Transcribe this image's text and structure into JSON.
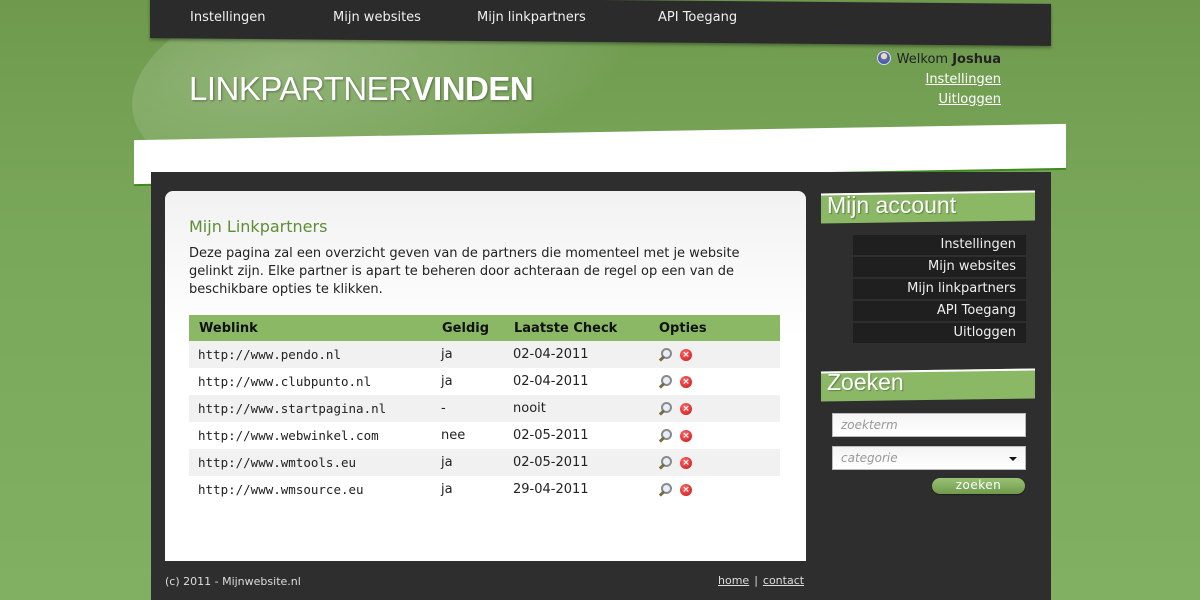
{
  "colors": {
    "accent": "#8bb865",
    "dark": "#2e2e2e",
    "heading": "#5e8e36",
    "delete": "#c81010"
  },
  "topnav": {
    "items": [
      "Instellingen",
      "Mijn websites",
      "Mijn linkpartners",
      "API Toegang"
    ]
  },
  "logo": {
    "light": "LINKPARTNER",
    "bold": "VINDEN"
  },
  "user": {
    "welcome": "Welkom",
    "name": "Joshua",
    "settings_link": "Instellingen",
    "logout_link": "Uitloggen"
  },
  "main": {
    "title": "Mijn Linkpartners",
    "intro": "Deze pagina zal een overzicht geven van de partners die momenteel met je website gelinkt zijn. Elke partner is apart te beheren door achteraan de regel op een van de beschikbare opties te klikken.",
    "table": {
      "headers": [
        "Weblink",
        "Geldig",
        "Laatste Check",
        "Opties"
      ],
      "rows": [
        [
          "http://www.pendo.nl",
          "ja",
          "02-04-2011"
        ],
        [
          "http://www.clubpunto.nl",
          "ja",
          "02-04-2011"
        ],
        [
          "http://www.startpagina.nl",
          "-",
          "nooit"
        ],
        [
          "http://www.webwinkel.com",
          "nee",
          "02-05-2011"
        ],
        [
          "http://www.wmtools.eu",
          "ja",
          "02-05-2011"
        ],
        [
          "http://www.wmsource.eu",
          "ja",
          "29-04-2011"
        ]
      ],
      "option_icons": [
        "magnifier-icon",
        "delete-icon"
      ]
    }
  },
  "sidebar": {
    "account_title": "Mijn account",
    "account_items": [
      "Instellingen",
      "Mijn websites",
      "Mijn linkpartners",
      "API Toegang",
      "Uitloggen"
    ],
    "search_title": "Zoeken",
    "search_placeholder": "zoekterm",
    "category_placeholder": "categorie",
    "search_button": "zoeken"
  },
  "footer": {
    "copyright": "(c) 2011 - Mijnwebsite.nl",
    "links": [
      "home",
      "contact"
    ],
    "separator": "|"
  }
}
